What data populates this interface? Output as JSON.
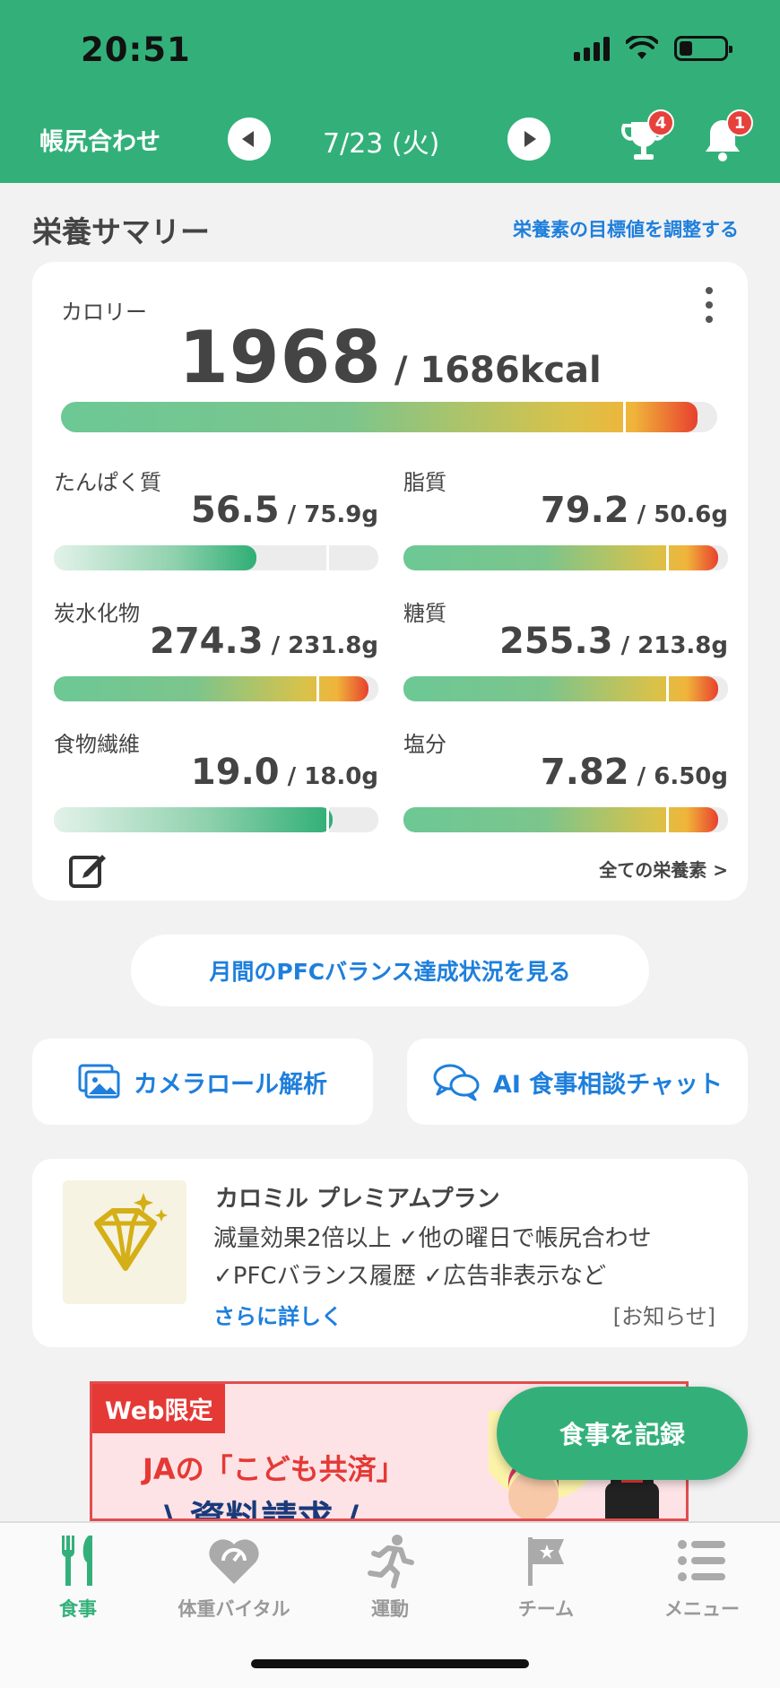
{
  "status": {
    "time": "20:51"
  },
  "header": {
    "left_label": "帳尻合わせ",
    "date": "7/23 (火)",
    "trophy_badge": "4",
    "bell_badge": "1"
  },
  "summary": {
    "title": "栄養サマリー",
    "adjust_link": "栄養素の目標値を調整する"
  },
  "calories": {
    "label": "カロリー",
    "value": "1968",
    "target": " / 1686kcal",
    "progress": 1.167,
    "target_ratio": 0.857
  },
  "nutrients": [
    {
      "label": "たんぱく質",
      "value": "56.5",
      "target": " / 75.9g",
      "progress": 0.744
    },
    {
      "label": "脂質",
      "value": "79.2",
      "target": " / 50.6g",
      "progress": 1.565
    },
    {
      "label": "炭水化物",
      "value": "274.3",
      "target": " / 231.8g",
      "progress": 1.183
    },
    {
      "label": "糖質",
      "value": "255.3",
      "target": " / 213.8g",
      "progress": 1.194
    },
    {
      "label": "食物繊維",
      "value": "19.0",
      "target": " / 18.0g",
      "progress": 1.056
    },
    {
      "label": "塩分",
      "value": "7.82",
      "target": " / 6.50g",
      "progress": 1.203
    }
  ],
  "card_footer": {
    "all_nutrients": "全ての栄養素 >"
  },
  "pfc_button": "月間のPFCバランス達成状況を見る",
  "actions": {
    "camera_roll": "カメラロール解析",
    "ai_chat": "AI 食事相談チャット"
  },
  "premium": {
    "title": "カロミル プレミアムプラン",
    "line1": "減量効果2倍以上 ✓他の曜日で帳尻合わせ",
    "line2": "✓PFCバランス履歴 ✓広告非表示など",
    "more": "さらに詳しく",
    "notice": "[お知らせ]"
  },
  "ad": {
    "tag": "Web限定",
    "text1": "JAの「こども共済」",
    "text2": "\\ 資料請求 /"
  },
  "fab": "食事を記録",
  "tabs": [
    {
      "label": "食事",
      "icon": "fork-knife-icon"
    },
    {
      "label": "体重バイタル",
      "icon": "heart-scale-icon"
    },
    {
      "label": "運動",
      "icon": "runner-icon"
    },
    {
      "label": "チーム",
      "icon": "flag-icon"
    },
    {
      "label": "メニュー",
      "icon": "list-icon"
    }
  ],
  "colors": {
    "brand_green": "#33b07a",
    "link_blue": "#1e7fdc",
    "badge_red": "#e6413b"
  }
}
